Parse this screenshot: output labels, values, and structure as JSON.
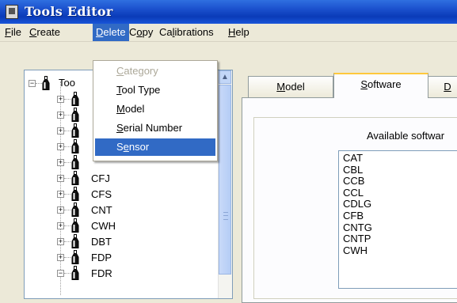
{
  "window": {
    "title": "Tools Editor",
    "icon": "app-tool-icon"
  },
  "menubar": [
    {
      "key": "file",
      "label": "File",
      "ul": "F",
      "rest": "ile"
    },
    {
      "key": "create",
      "label": "Create",
      "ul": "C",
      "rest": "reate"
    },
    {
      "key": "delete",
      "label": "Delete",
      "ul": "D",
      "rest": "elete",
      "active": true
    },
    {
      "key": "copy",
      "label": "Copy",
      "pre": "C",
      "ul": "o",
      "rest": "py"
    },
    {
      "key": "calibrations",
      "label": "Calibrations",
      "pre": "Ca",
      "ul": "l",
      "rest": "ibrations"
    },
    {
      "key": "help",
      "label": "Help",
      "ul": "H",
      "rest": "elp"
    }
  ],
  "delete_menu": [
    {
      "label": "Category",
      "ul": "C",
      "rest": "ategory",
      "disabled": true
    },
    {
      "label": "Tool Type",
      "ul": "T",
      "rest": "ool Type"
    },
    {
      "label": "Model",
      "ul": "M",
      "rest": "odel"
    },
    {
      "label": "Serial Number",
      "ul": "S",
      "rest": "erial Number"
    },
    {
      "label": "Sensor",
      "pre": "S",
      "ul": "e",
      "rest": "nsor",
      "highlighted": true
    }
  ],
  "tree": {
    "root_label": "Too",
    "items": [
      "",
      "",
      "",
      "",
      "",
      "CFJ",
      "CFS",
      "CNT",
      "CWH",
      "DBT",
      "FDP",
      "FDR"
    ]
  },
  "tabs": [
    {
      "key": "model",
      "label": "Model",
      "ul": "M",
      "rest": "odel"
    },
    {
      "key": "software",
      "label": "Software",
      "ul": "S",
      "rest": "oftware",
      "selected": true
    },
    {
      "key": "third",
      "label": "D",
      "ul": "D",
      "rest": ""
    }
  ],
  "software_panel": {
    "heading": "Available softwar",
    "items": [
      "CAT",
      "CBL",
      "CCB",
      "CCL",
      "CDLG",
      "CFB",
      "CNTG",
      "CNTP",
      "CWH"
    ]
  },
  "colors": {
    "selection": "#316ac5",
    "titlebar": "#0a3bb8",
    "dialog": "#ece9d8"
  }
}
